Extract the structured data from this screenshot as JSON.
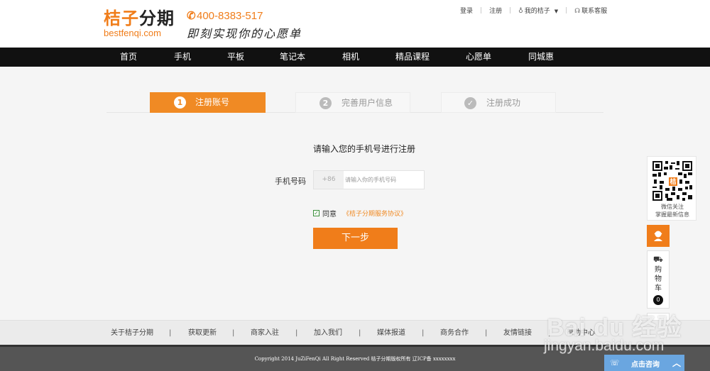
{
  "header": {
    "logo_cn_orange": "桔子",
    "logo_cn_dark": "分期",
    "logo_en": "bestfenqi.com",
    "hotline": "400-8383-517",
    "slogan": "即刻实现你的心愿单",
    "top_links": {
      "login": "登录",
      "register": "注册",
      "my_juzi": "我的桔子",
      "contact": "联系客服"
    }
  },
  "nav": {
    "items": [
      "首页",
      "手机",
      "平板",
      "笔记本",
      "相机",
      "精品课程",
      "心愿单",
      "同城惠"
    ]
  },
  "steps": [
    {
      "num": "1",
      "label": "注册账号"
    },
    {
      "num": "2",
      "label": "完善用户信息"
    },
    {
      "num": "✓",
      "label": "注册成功"
    }
  ],
  "form": {
    "title": "请输入您的手机号进行注册",
    "phone_label": "手机号码",
    "phone_prefix": "+86",
    "phone_placeholder": "请输入你的手机号码",
    "agree_label": "同意",
    "agreement_link": "《桔子分期服务协议》",
    "agree_checked": true,
    "next_button": "下一步"
  },
  "sidebar": {
    "qr_logo": "桔",
    "qr_line1": "微信关注",
    "qr_line2": "掌握最新信息",
    "cart_label": "购物车",
    "cart_count": "0",
    "top_label": "⇡"
  },
  "footer": {
    "links": [
      "关于桔子分期",
      "获取更新",
      "商家入驻",
      "加入我们",
      "媒体报道",
      "商务合作",
      "友情链接",
      "帮助中心"
    ],
    "separator": "|",
    "copyright": "Copyright 2014 JuZiFenQi All Right Reserved 桔子分期版权所有 辽ICP备 xxxxxxxx"
  },
  "consult": {
    "label": "点击咨询",
    "caret": "︿"
  },
  "watermark": {
    "logo": "Bai du 经验",
    "url": "jingyan.baidu.com"
  },
  "colors": {
    "brand_orange": "#f07d1a",
    "nav_black": "#111111",
    "consult_blue": "#6aa6e0"
  }
}
